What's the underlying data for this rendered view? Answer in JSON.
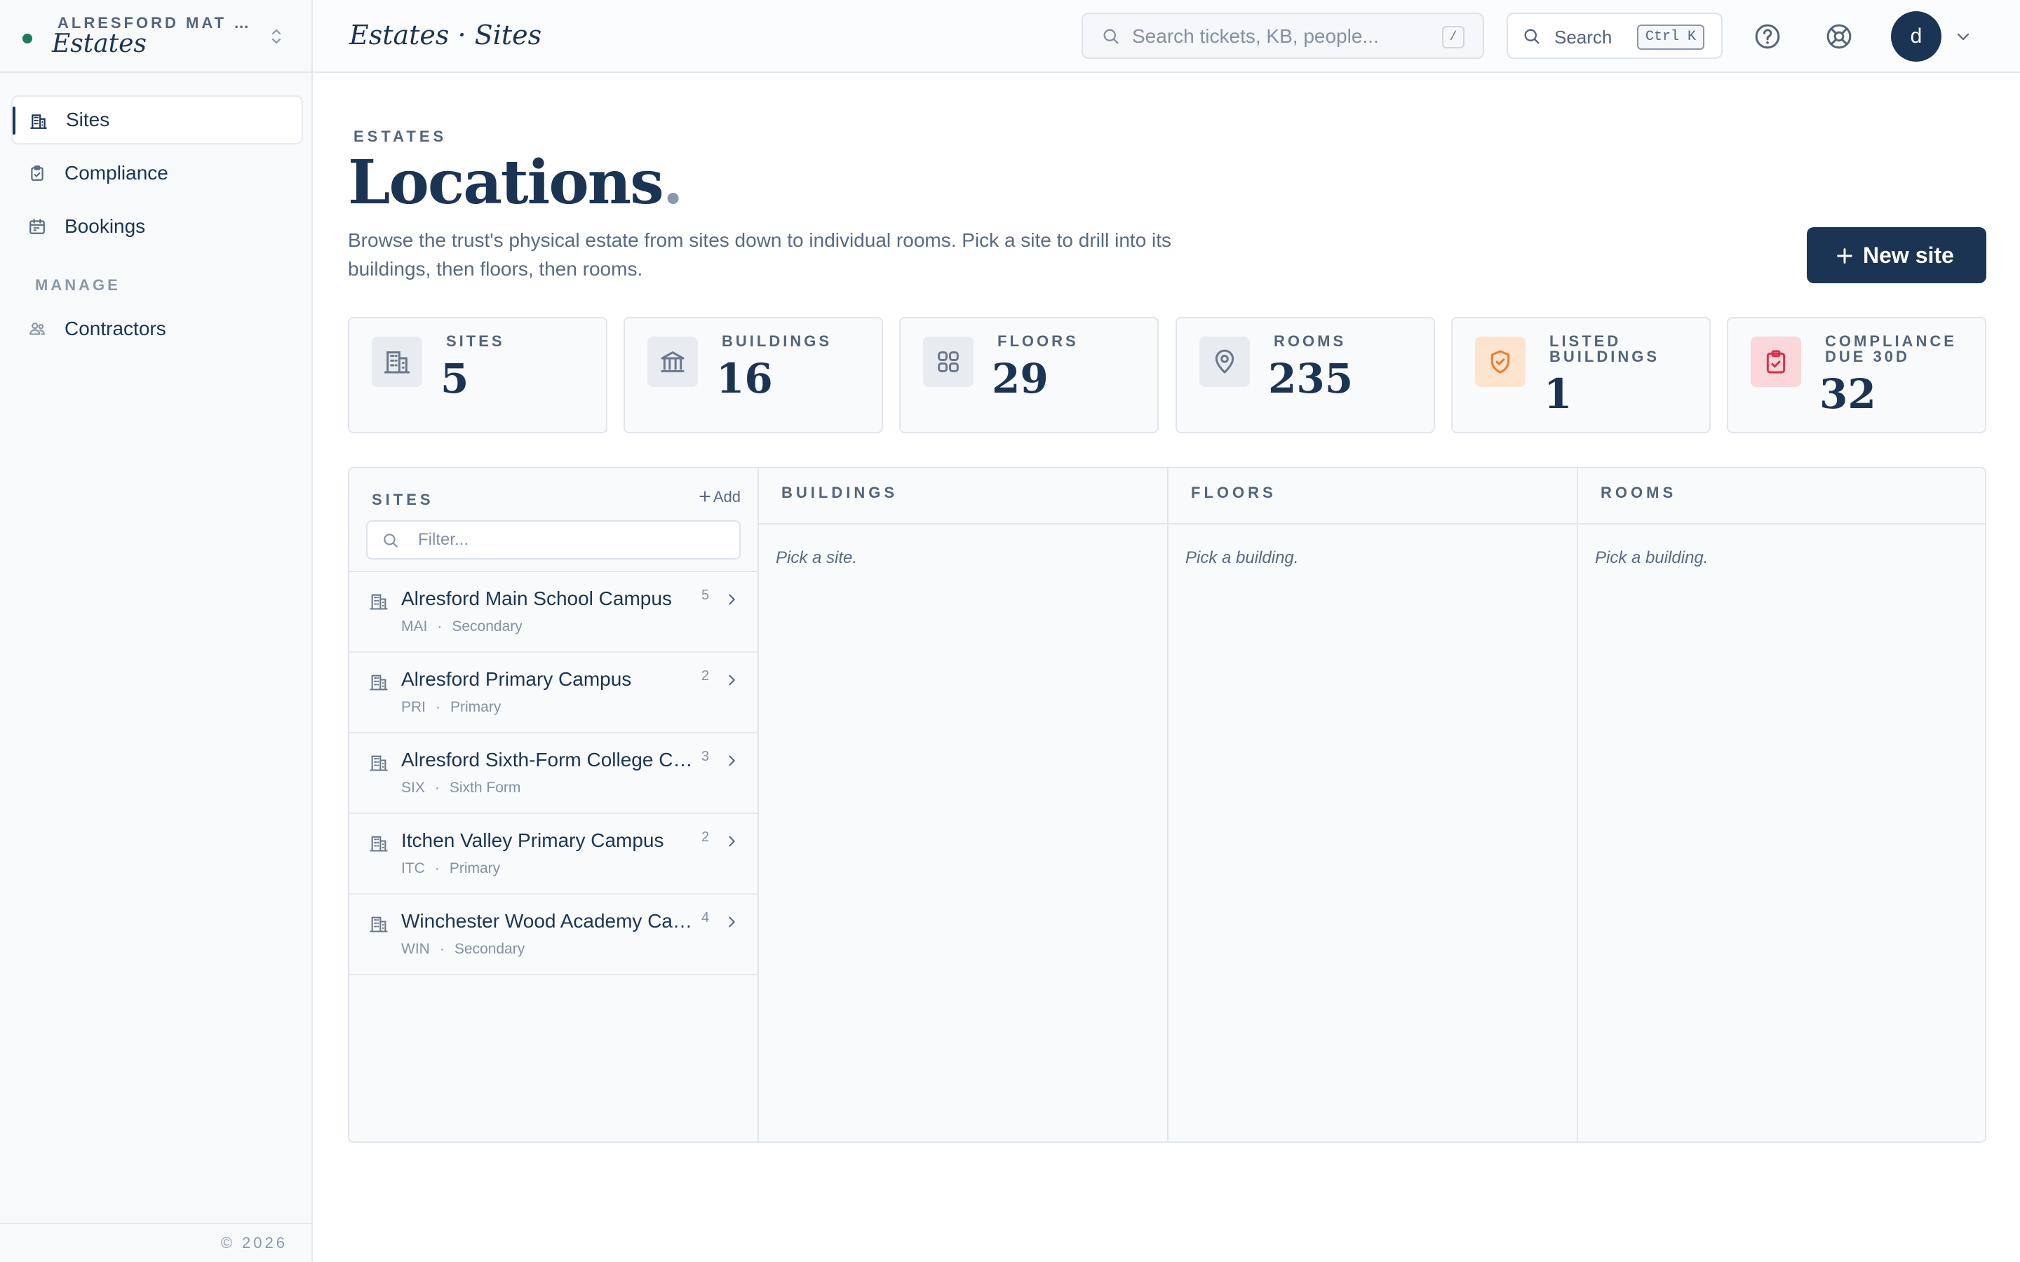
{
  "workspace": {
    "org": "ALRESFORD MAT …",
    "name": "Estates"
  },
  "nav": {
    "items": [
      {
        "label": "Sites",
        "icon": "building-icon",
        "active": true
      },
      {
        "label": "Compliance",
        "icon": "clipboard-check-icon"
      },
      {
        "label": "Bookings",
        "icon": "calendar-icon"
      }
    ],
    "section_label": "MANAGE",
    "manage_items": [
      {
        "label": "Contractors",
        "icon": "people-icon"
      }
    ]
  },
  "footer": {
    "copyright": "© 2026"
  },
  "topbar": {
    "breadcrumb": "Estates · Sites",
    "search_placeholder": "Search tickets, KB, people...",
    "search_shortcut": "/",
    "command_label": "Search",
    "command_shortcut": "Ctrl K",
    "avatar_initial": "d"
  },
  "page": {
    "eyebrow": "ESTATES",
    "title": "Locations",
    "title_dot": ".",
    "description": "Browse the trust's physical estate from sites down to individual rooms. Pick a site to drill into its buildings, then floors, then rooms.",
    "new_button": "New site"
  },
  "stats": [
    {
      "label": "SITES",
      "value": "5",
      "icon": "building-icon",
      "tone": "neutral"
    },
    {
      "label": "BUILDINGS",
      "value": "16",
      "icon": "landmark-icon",
      "tone": "neutral"
    },
    {
      "label": "FLOORS",
      "value": "29",
      "icon": "grid-icon",
      "tone": "neutral"
    },
    {
      "label": "ROOMS",
      "value": "235",
      "icon": "map-pin-icon",
      "tone": "neutral"
    },
    {
      "label": "LISTED BUILDINGS",
      "value": "1",
      "icon": "shield-check-icon",
      "tone": "orange"
    },
    {
      "label": "COMPLIANCE DUE 30D",
      "value": "32",
      "icon": "clipboard-check-icon",
      "tone": "red"
    }
  ],
  "sites_panel": {
    "title": "SITES",
    "add_label": "Add",
    "filter_placeholder": "Filter...",
    "rows": [
      {
        "name": "Alresford Main School Campus",
        "code": "MAI",
        "phase": "Secondary",
        "count": "5"
      },
      {
        "name": "Alresford Primary Campus",
        "code": "PRI",
        "phase": "Primary",
        "count": "2"
      },
      {
        "name": "Alresford Sixth-Form College Campus",
        "code": "SIX",
        "phase": "Sixth Form",
        "count": "3"
      },
      {
        "name": "Itchen Valley Primary Campus",
        "code": "ITC",
        "phase": "Primary",
        "count": "2"
      },
      {
        "name": "Winchester Wood Academy Campus",
        "code": "WIN",
        "phase": "Secondary",
        "count": "4"
      }
    ],
    "separator": "·"
  },
  "columns": [
    {
      "title": "BUILDINGS",
      "empty": "Pick a site."
    },
    {
      "title": "FLOORS",
      "empty": "Pick a building."
    },
    {
      "title": "ROOMS",
      "empty": "Pick a building."
    }
  ],
  "colors": {
    "primary": "#1c3453",
    "accent_green": "#1f7a5b",
    "orange": "#f07a2a",
    "red": "#d8304a"
  }
}
